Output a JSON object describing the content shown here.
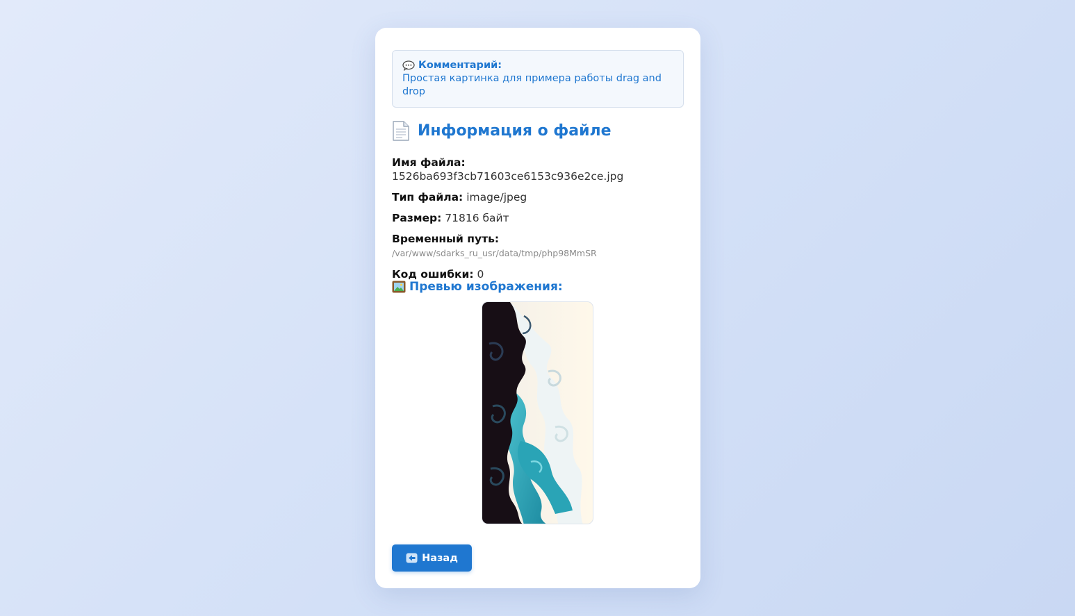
{
  "comment": {
    "icon": "speech-bubble-icon",
    "title": "Комментарий:",
    "text": "Простая картинка для примера работы drag and drop"
  },
  "file_info": {
    "icon": "document-icon",
    "title": "Информация о файле",
    "rows": [
      {
        "label": "Имя файла:",
        "value": "1526ba693f3cb71603ce6153c936e2ce.jpg"
      },
      {
        "label": "Тип файла:",
        "value": "image/jpeg"
      },
      {
        "label": "Размер:",
        "value": "71816 байт"
      },
      {
        "label": "Временный путь:",
        "value": "/var/www/sdarks_ru_usr/data/tmp/php98MmSR"
      },
      {
        "label": "Код ошибки:",
        "value": "0"
      }
    ]
  },
  "preview": {
    "icon": "framed-picture-icon",
    "title": "Превью изображения:",
    "image_description_colors": [
      "#180f16",
      "#2bb0c4",
      "#fdf6e8"
    ]
  },
  "back_button": {
    "icon": "back-arrow-icon",
    "label": "Назад"
  },
  "colors": {
    "accent": "#1f77d0",
    "comment_bg": "#f4f8fd"
  }
}
